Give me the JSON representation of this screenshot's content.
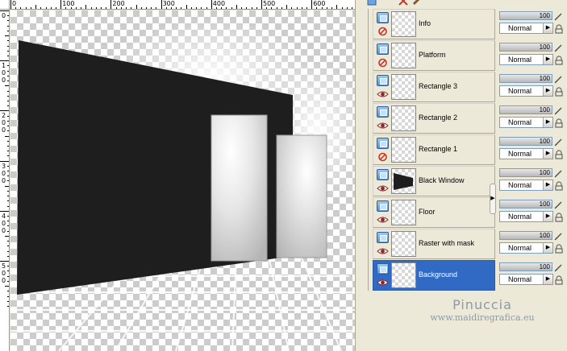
{
  "ruler": {
    "top_labels": [
      "0",
      "100",
      "200",
      "300",
      "400",
      "500",
      "600"
    ],
    "left_labels": [
      "0",
      "1 0 0",
      "2 0 0",
      "3 0 0",
      "4 0 0",
      "5 0 0"
    ]
  },
  "layers": [
    {
      "name": "Info",
      "visible": false
    },
    {
      "name": "Platform",
      "visible": false
    },
    {
      "name": "Rectangle 3",
      "visible": true
    },
    {
      "name": "Rectangle 2",
      "visible": true
    },
    {
      "name": "Rectangle 1",
      "visible": false
    },
    {
      "name": "Black Window",
      "visible": true
    },
    {
      "name": "Floor",
      "visible": true
    },
    {
      "name": "Raster with mask",
      "visible": true
    },
    {
      "name": "Background",
      "visible": true,
      "selected": true
    }
  ],
  "opacity": {
    "value": "100",
    "blend": "Normal"
  },
  "palette": {
    "collapse_arrow": "▶",
    "blend_arrow": "▶"
  },
  "watermark": {
    "title": "Pinuccia",
    "url": "www.maidiregrafica.eu"
  },
  "colors": {
    "selected": "#316ac5",
    "panel": "#ece9d8",
    "black_window": "#1e1e1e",
    "eye": "#8b2a2a",
    "hidden": "#c0392b"
  },
  "icons": {
    "visible": "eye-icon",
    "hidden": "hidden-icon",
    "layer": "raster-layer-icon",
    "edit": "pencil-icon",
    "lock": "lock-icon"
  }
}
